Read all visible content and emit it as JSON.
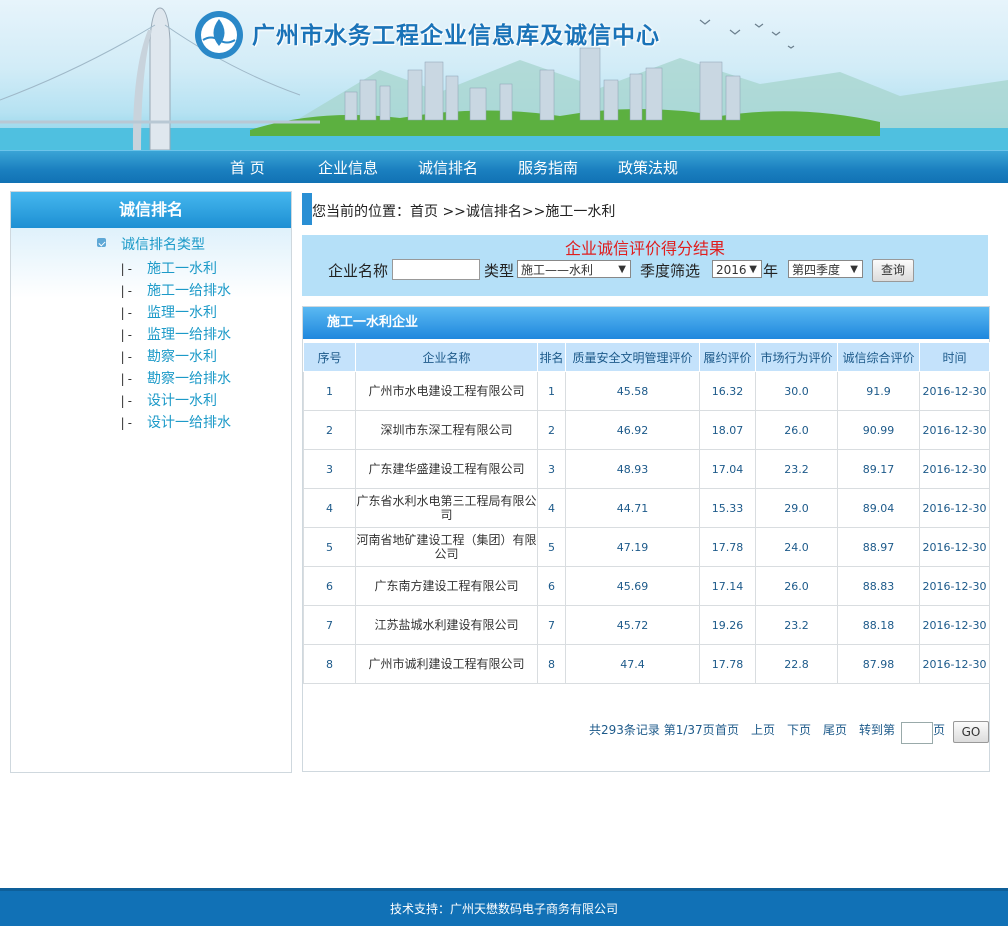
{
  "site": {
    "title": "广州市水务工程企业信息库及诚信中心"
  },
  "nav": {
    "items": [
      "首 页",
      "企业信息",
      "诚信排名",
      "服务指南",
      "政策法规"
    ]
  },
  "sidebar": {
    "heading": "诚信排名",
    "category_title": "诚信排名类型",
    "tree_prefix": "|-",
    "items": [
      "施工一水利",
      "施工一给排水",
      "监理一水利",
      "监理一给排水",
      "勘察一水利",
      "勘察一给排水",
      "设计一水利",
      "设计一给排水"
    ]
  },
  "breadcrumb": {
    "text": "您当前的位置：首页 >>诚信排名>>施工一水利"
  },
  "search": {
    "title": "企业诚信评价得分结果",
    "name_label": "企业名称",
    "name_value": "",
    "type_label": "类型",
    "type_value": "施工——水利",
    "quarter_label": "季度筛选",
    "year_value": "2016",
    "year_suffix": "年",
    "quarter_value": "第四季度",
    "query_label": "查询"
  },
  "list": {
    "heading": "施工一水利企业",
    "columns": [
      "序号",
      "企业名称",
      "排名",
      "质量安全文明管理评价",
      "履约评价",
      "市场行为评价",
      "诚信综合评价",
      "时间"
    ],
    "rows": [
      [
        "1",
        "广州市水电建设工程有限公司",
        "1",
        "45.58",
        "16.32",
        "30.0",
        "91.9",
        "2016-12-30"
      ],
      [
        "2",
        "深圳市东深工程有限公司",
        "2",
        "46.92",
        "18.07",
        "26.0",
        "90.99",
        "2016-12-30"
      ],
      [
        "3",
        "广东建华盛建设工程有限公司",
        "3",
        "48.93",
        "17.04",
        "23.2",
        "89.17",
        "2016-12-30"
      ],
      [
        "4",
        "广东省水利水电第三工程局有限公司",
        "4",
        "44.71",
        "15.33",
        "29.0",
        "89.04",
        "2016-12-30"
      ],
      [
        "5",
        "河南省地矿建设工程（集团）有限公司",
        "5",
        "47.19",
        "17.78",
        "24.0",
        "88.97",
        "2016-12-30"
      ],
      [
        "6",
        "广东南方建设工程有限公司",
        "6",
        "45.69",
        "17.14",
        "26.0",
        "88.83",
        "2016-12-30"
      ],
      [
        "7",
        "江苏盐城水利建设有限公司",
        "7",
        "45.72",
        "19.26",
        "23.2",
        "88.18",
        "2016-12-30"
      ],
      [
        "8",
        "广州市诚利建设工程有限公司",
        "8",
        "47.4",
        "17.78",
        "22.8",
        "87.98",
        "2016-12-30"
      ]
    ]
  },
  "pager": {
    "summary": "共293条记录 第1/37页",
    "first": "首页",
    "prev": "上页",
    "next": "下页",
    "last": "尾页",
    "goto_label": "转到第",
    "page_suffix": "页",
    "go_label": "GO"
  },
  "footer": {
    "text": "技术支持：广州天懋数码电子商务有限公司"
  }
}
